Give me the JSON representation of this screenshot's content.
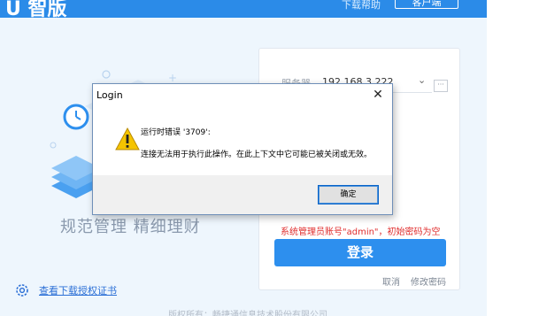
{
  "app": {
    "logo_text": "U 智版",
    "top_link": "下载帮助",
    "top_button": "客户端",
    "slogan": "规范管理  精细理财",
    "license_link": "查看下载授权证书",
    "copyright": "版权所有：畅捷通信息技术股份有限公司"
  },
  "login_form": {
    "server_label": "服务器",
    "server_value": "192.168.3.222",
    "admin_hint": "系统管理员账号\"admin\"，初始密码为空",
    "login_button": "登录",
    "cancel_link": "取消",
    "change_password_link": "修改密码"
  },
  "dialog": {
    "title": "Login",
    "close_symbol": "✕",
    "error_line1": "运行时错误 '3709':",
    "error_line2": "连接无法用于执行此操作。在此上下文中它可能已被关闭或无效。",
    "ok_button": "确定"
  },
  "colors": {
    "accent_blue": "#2d8fee",
    "hint_red": "#e02d2d",
    "warning_yellow": "#f5c400"
  },
  "icons": {
    "dialog_icon": "warning-icon",
    "license_icon": "gear-icon",
    "server_dropdown_icon": "chevron-down-icon",
    "server_more_icon": "more-icon"
  }
}
